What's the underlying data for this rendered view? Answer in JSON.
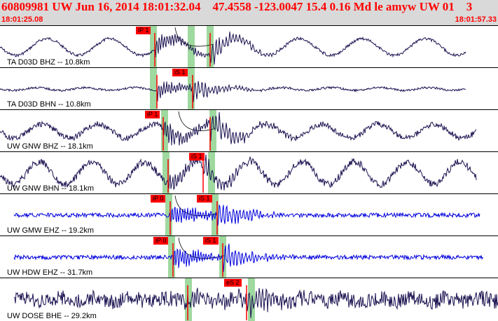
{
  "header": {
    "event_info": "60809981 UW Jun 16, 2014 18:01:32.04    47.4558 -123.0047 15.4 0.16 Md le amyw UW 01    3",
    "start_time": "18:01:25.08",
    "end_time": "18:01:57.33"
  },
  "colors": {
    "header_bg": "#d9d9d9",
    "header_text": "#ff0000",
    "trace_dark": "#1a1250",
    "trace_blue": "#0000dd",
    "pick_box": "#ff0000",
    "window_green": "#9fd99f"
  },
  "panels": [
    {
      "label": "TA D03D BHZ -- 10.8km",
      "pick_labels": [
        "iP 1"
      ],
      "color": "dark"
    },
    {
      "label": "TA D03D BHN -- 10.8km",
      "pick_labels": [
        "iS 1"
      ],
      "color": "dark"
    },
    {
      "label": "UW GNW BHZ -- 18.1km",
      "pick_labels": [
        "iP 1"
      ],
      "color": "dark"
    },
    {
      "label": "UW GNW BHN -- 18.1km",
      "pick_labels": [
        "iS 1"
      ],
      "color": "dark"
    },
    {
      "label": "UW GMW EHZ -- 19.2km",
      "pick_labels": [
        "iP 0",
        "iS 1"
      ],
      "color": "blue"
    },
    {
      "label": "UW HDW EHZ -- 31.7km",
      "pick_labels": [
        "iP 0",
        "iS 1"
      ],
      "color": "blue"
    },
    {
      "label": "UW DOSE BHE -- 29.2km",
      "pick_labels": [
        "eS 2"
      ],
      "color": "dark"
    }
  ]
}
